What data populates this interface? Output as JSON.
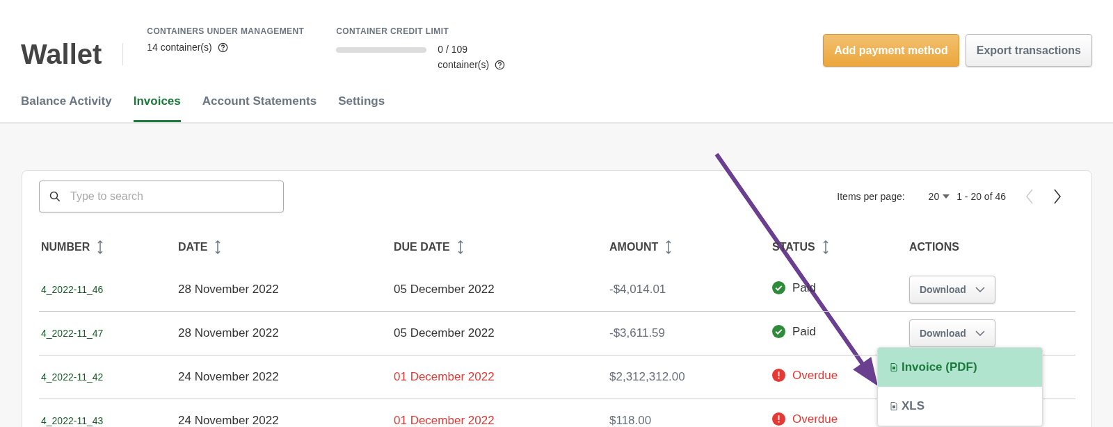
{
  "header": {
    "title": "Wallet",
    "stats": [
      {
        "kind": "count",
        "label": "CONTAINERS UNDER MANAGEMENT",
        "value": "14 container(s)"
      },
      {
        "kind": "meter",
        "label": "CONTAINER CREDIT LIMIT",
        "level": 0,
        "value_line_1": "0 / 109",
        "value": "container(s)"
      }
    ],
    "buttons": [
      {
        "kind": "primary",
        "label": "Add payment method"
      },
      {
        "kind": "secondary",
        "label": "Export transactions"
      }
    ]
  },
  "tabs": [
    {
      "label": "Balance Activity",
      "selected": false
    },
    {
      "label": "Invoices",
      "selected": true
    },
    {
      "label": "Account Statements",
      "selected": false
    },
    {
      "label": "Settings",
      "selected": false
    }
  ],
  "search": {
    "placeholder": "Type to search"
  },
  "pagination": {
    "label": "Items per page:",
    "per_page": "20",
    "range": "1 - 20 of 46",
    "prev_disabled": true
  },
  "table": {
    "columns": [
      {
        "label": "NUMBER",
        "sortable": true
      },
      {
        "label": "DATE",
        "sortable": true
      },
      {
        "label": "DUE DATE",
        "sortable": true
      },
      {
        "label": "AMOUNT",
        "sortable": true
      },
      {
        "label": "STATUS",
        "sortable": true
      },
      {
        "label": "ACTIONS",
        "sortable": false
      }
    ],
    "rows": [
      {
        "number": "4_2022-11_46",
        "date": "28 November 2022",
        "due_date": "05 December 2022",
        "overdue": false,
        "amount": "-$4,014.01",
        "status": {
          "kind": "paid",
          "label": "Paid"
        },
        "action": "Download"
      },
      {
        "number": "4_2022-11_47",
        "date": "28 November 2022",
        "due_date": "05 December 2022",
        "overdue": false,
        "amount": "-$3,611.59",
        "status": {
          "kind": "paid",
          "label": "Paid"
        },
        "action": "Download",
        "menu": [
          {
            "label": "Invoice (PDF)",
            "selected": true
          },
          {
            "label": "XLS",
            "selected": false
          }
        ]
      },
      {
        "number": "4_2022-11_42",
        "date": "24 November 2022",
        "due_date": "01 December 2022",
        "overdue": true,
        "amount": "$2,312,312.00",
        "status": {
          "kind": "overdue",
          "label": "Overdue"
        }
      },
      {
        "number": "4_2022-11_43",
        "date": "24 November 2022",
        "due_date": "01 December 2022",
        "overdue": true,
        "amount": "$118.00",
        "status": {
          "kind": "overdue",
          "label": "Overdue"
        }
      }
    ]
  }
}
